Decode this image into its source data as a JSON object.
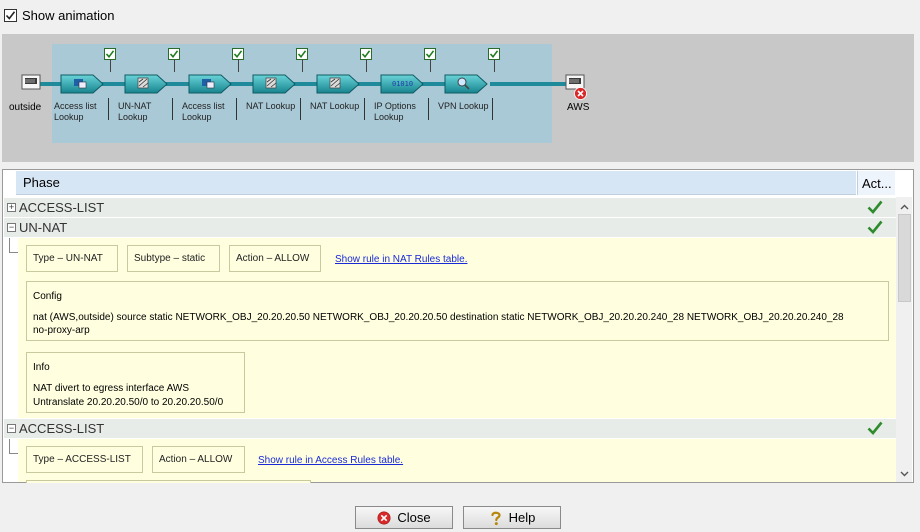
{
  "options": {
    "show_animation_label": "Show animation",
    "show_animation_checked": true
  },
  "diagram": {
    "source_label": "outside",
    "destination_label": "AWS",
    "stages": [
      {
        "label": [
          "Access list",
          "Lookup"
        ],
        "icon": "access-list-icon",
        "checked": true
      },
      {
        "label": [
          "UN-NAT",
          "Lookup"
        ],
        "icon": "nat-icon",
        "checked": true
      },
      {
        "label": [
          "Access list",
          "Lookup"
        ],
        "icon": "access-list-icon",
        "checked": true
      },
      {
        "label": [
          "NAT Lookup"
        ],
        "icon": "nat-icon",
        "checked": true
      },
      {
        "label": [
          "NAT Lookup"
        ],
        "icon": "nat-icon",
        "checked": true
      },
      {
        "label": [
          "IP Options",
          "Lookup"
        ],
        "icon": "ip-options-icon",
        "checked": true
      },
      {
        "label": [
          "VPN Lookup"
        ],
        "icon": "search-icon",
        "checked": true
      }
    ]
  },
  "table": {
    "columns": {
      "phase": "Phase",
      "action": "Act..."
    },
    "rows": [
      {
        "phase": "ACCESS-LIST",
        "expanded": false,
        "status": "allow"
      },
      {
        "phase": "UN-NAT",
        "expanded": true,
        "status": "allow"
      },
      {
        "phase": "ACCESS-LIST",
        "expanded": true,
        "status": "allow"
      }
    ],
    "unnat_detail": {
      "type": "Type –  UN-NAT",
      "subtype": "Subtype –  static",
      "action": "Action –  ALLOW",
      "link": "Show rule in NAT Rules table.",
      "config_title": "Config",
      "config_line1": "nat (AWS,outside) source static NETWORK_OBJ_20.20.20.50 NETWORK_OBJ_20.20.20.50 destination static NETWORK_OBJ_20.20.20.240_28 NETWORK_OBJ_20.20.20.240_28",
      "config_line2": "no-proxy-arp",
      "info_title": "Info",
      "info_line1": "NAT divert to egress interface AWS",
      "info_line2": "Untranslate 20.20.20.50/0 to 20.20.20.50/0"
    },
    "acl_detail": {
      "type": "Type –  ACCESS-LIST",
      "action": "Action –  ALLOW",
      "link": "Show rule in Access Rules table."
    }
  },
  "buttons": {
    "close": "Close",
    "help": "Help"
  },
  "colors": {
    "allow_green": "#2e8b2e",
    "error_red": "#d8282a",
    "pipe": "#1f8a9a"
  }
}
